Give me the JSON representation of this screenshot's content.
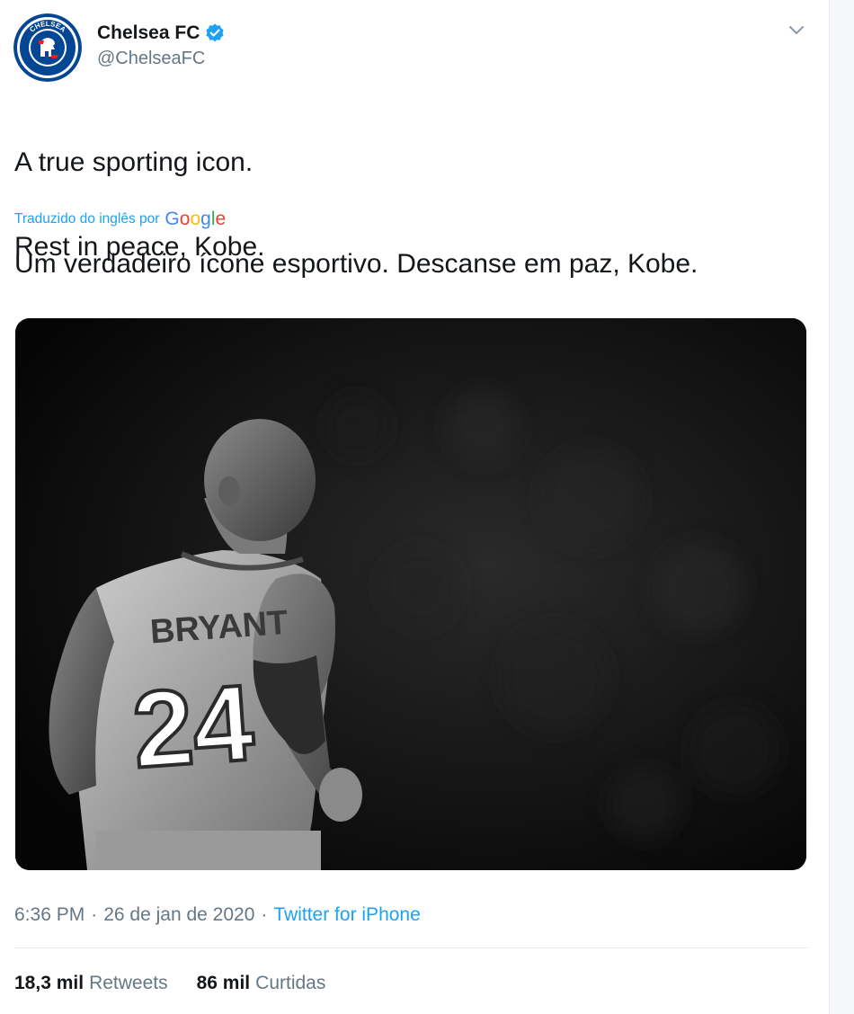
{
  "author": {
    "name": "Chelsea FC",
    "handle": "@ChelseaFC",
    "avatar_badge_text": "CHELSEA",
    "verified_color": "#1da1f2"
  },
  "tweet": {
    "text_line1": "A true sporting icon.",
    "text_line2": "Rest in peace, Kobe.",
    "translated_label": "Traduzido do inglês por",
    "translation": "Um verdadeiro ícone esportivo. Descanse em paz, Kobe."
  },
  "media": {
    "jersey_name": "BRYANT",
    "jersey_number": "24"
  },
  "meta": {
    "time": "6:36 PM",
    "date": "26 de jan de 2020",
    "separator": "·",
    "source": "Twitter for iPhone"
  },
  "stats": {
    "retweets_count": "18,3 mil",
    "retweets_label": "Retweets",
    "likes_count": "86 mil",
    "likes_label": "Curtidas"
  },
  "colors": {
    "text_primary": "#14171a",
    "text_secondary": "#657786",
    "link": "#1da1f2",
    "chelsea_blue": "#034694"
  },
  "icons": {
    "verified": "verified-badge-icon",
    "caret": "chevron-down-icon",
    "google": "google-logo"
  }
}
